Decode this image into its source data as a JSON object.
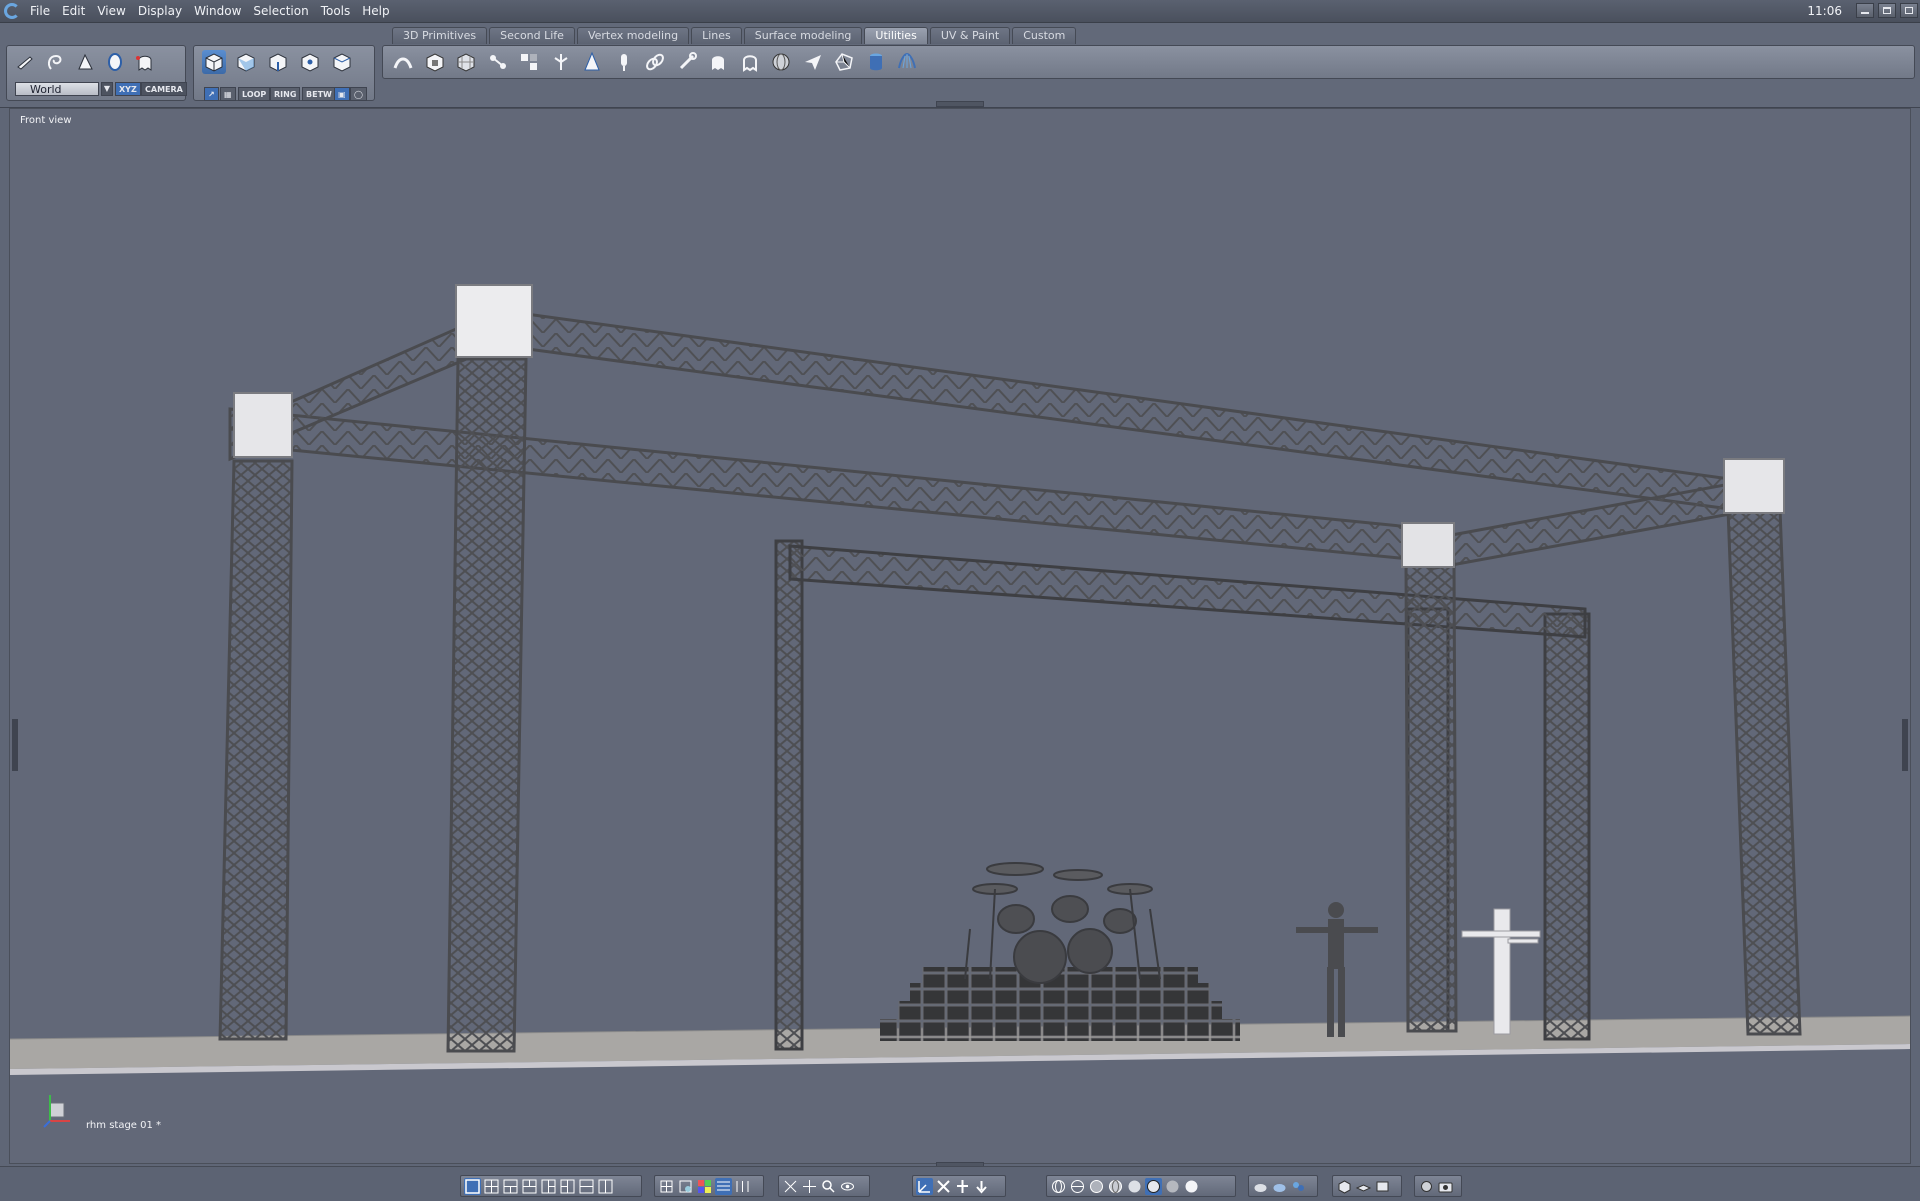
{
  "menubar": {
    "items": [
      "File",
      "Edit",
      "View",
      "Display",
      "Window",
      "Selection",
      "Tools",
      "Help"
    ],
    "clock": "11:06"
  },
  "tabs": [
    "3D Primitives",
    "Second Life",
    "Vertex modeling",
    "Lines",
    "Surface modeling",
    "Utilities",
    "UV & Paint",
    "Custom"
  ],
  "active_tab": "Utilities",
  "select_panel": {
    "coord_system": "World",
    "xyz_label": "XYZ",
    "camera_label": "CAMERA"
  },
  "mesh_panel": {
    "loop_label": "LOOP",
    "ring_label": "RING",
    "betw_label": "BETW"
  },
  "viewport": {
    "view_name": "Front view",
    "object_name": "rhm stage 01 *"
  },
  "utility_icons": [
    "weld-icon",
    "hollow-icon",
    "box-grid-icon",
    "connect-icon",
    "explode-icon",
    "split-icon",
    "cone-point-icon",
    "pin-icon",
    "chain-link-icon",
    "link-icon",
    "ghost-icon",
    "ghost-outline-icon",
    "sphere-icon",
    "send-icon",
    "decimate-icon",
    "cylinder-icon",
    "drape-icon"
  ],
  "colors": {
    "background": "#5f6676",
    "accent": "#3f6fb5",
    "truss": "#5a5a5a",
    "floor": "#a9a7a4"
  }
}
